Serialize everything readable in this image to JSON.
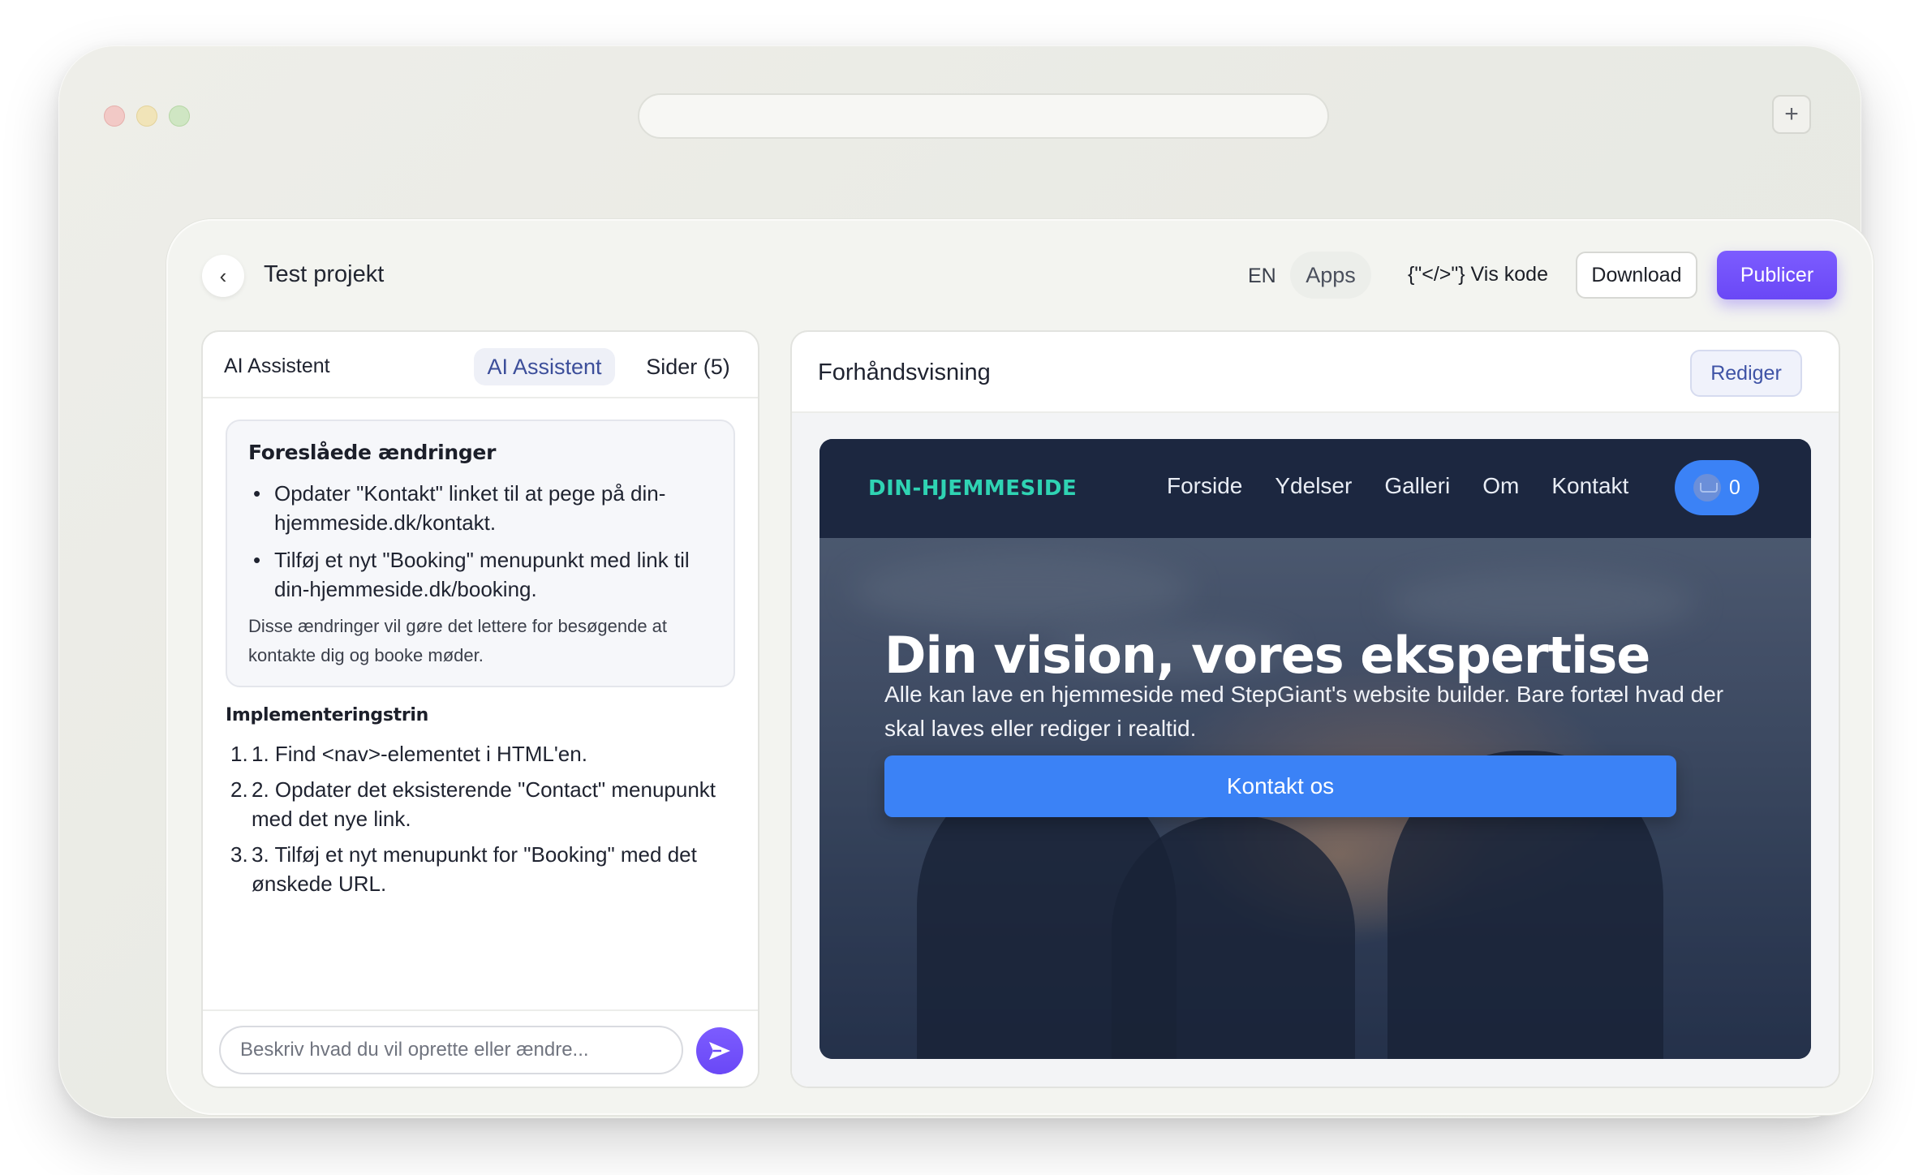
{
  "browser": {
    "plus_label": "+"
  },
  "header": {
    "back_label": "‹",
    "project_title": "Test projekt",
    "language": "EN",
    "apps_label": "Apps",
    "code_label": "{\"</>\"} Vis kode",
    "download_label": "Download",
    "publish_label": "Publicer"
  },
  "assistant": {
    "title": "AI Assistent",
    "tabs": [
      {
        "label": "AI Assistent",
        "active": true
      },
      {
        "label": "Sider (5)",
        "active": false
      }
    ],
    "suggestion": {
      "heading": "Foreslåede ændringer",
      "items": [
        "Opdater \"Kontakt\" linket til at pege på din-hjemmeside.dk/kontakt.",
        "Tilføj et nyt \"Booking\" menupunkt med link til din-hjemmeside.dk/booking."
      ],
      "note": "Disse ændringer vil gøre det lettere for besøgende at kontakte dig og booke møder."
    },
    "steps_heading": "Implementeringstrin",
    "steps": [
      {
        "num": "1.",
        "text": "1. Find <nav>-elementet i HTML'en."
      },
      {
        "num": "2.",
        "text": "2. Opdater det eksisterende \"Contact\" menupunkt med det nye link."
      },
      {
        "num": "3.",
        "text": "3. Tilføj et nyt menupunkt for \"Booking\" med det ønskede URL."
      }
    ],
    "input_placeholder": "Beskriv hvad du vil oprette eller ændre...",
    "send_icon": "send-icon"
  },
  "preview": {
    "title": "Forhåndsvisning",
    "edit_label": "Rediger",
    "site": {
      "logo": "DIN-HJEMMESIDE",
      "nav": [
        "Forside",
        "Ydelser",
        "Galleri",
        "Om",
        "Kontakt"
      ],
      "cart_count": "0",
      "hero_title": "Din vision, vores ekspertise",
      "hero_subtitle": "Alle kan lave en hjemmeside med StepGiant's website builder. Bare fortæl hvad der skal laves eller rediger i realtid.",
      "cta_label": "Kontakt os"
    }
  },
  "colors": {
    "accent_purple": "#6a48f6",
    "site_blue": "#3b82f6",
    "logo_teal": "#2fd3b3",
    "site_nav_bg": "#1c2740"
  }
}
